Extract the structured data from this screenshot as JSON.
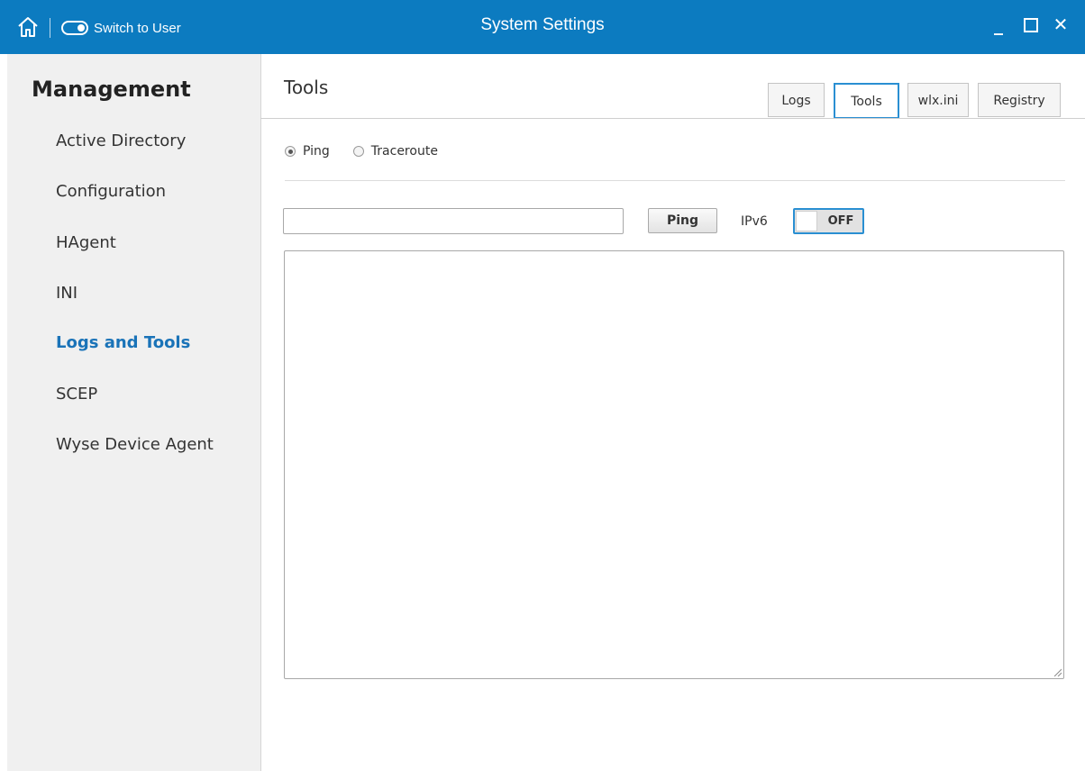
{
  "window": {
    "title": "System Settings",
    "switch_label": "Switch to User",
    "controls": {
      "minimize": "_",
      "close": "✕"
    },
    "accent": "#0c7bc0"
  },
  "sidebar": {
    "heading": "Management",
    "items": [
      {
        "label": "Active Directory",
        "active": false
      },
      {
        "label": "Configuration",
        "active": false
      },
      {
        "label": "HAgent",
        "active": false
      },
      {
        "label": "INI",
        "active": false
      },
      {
        "label": "Logs and Tools",
        "active": true
      },
      {
        "label": "SCEP",
        "active": false
      },
      {
        "label": "Wyse Device Agent",
        "active": false
      }
    ],
    "active_color": "#1a73b8"
  },
  "main": {
    "title": "Tools",
    "tabs": [
      {
        "label": "Logs",
        "active": false
      },
      {
        "label": "Tools",
        "active": true
      },
      {
        "label": "wlx.ini",
        "active": false
      },
      {
        "label": "Registry",
        "active": false
      }
    ],
    "mode": {
      "options": [
        {
          "label": "Ping",
          "checked": true
        },
        {
          "label": "Traceroute",
          "checked": false
        }
      ]
    },
    "host_input": {
      "value": "",
      "placeholder": ""
    },
    "ping_button": "Ping",
    "ipv6_label": "IPv6",
    "ipv6_toggle": "OFF",
    "output_text": ""
  }
}
